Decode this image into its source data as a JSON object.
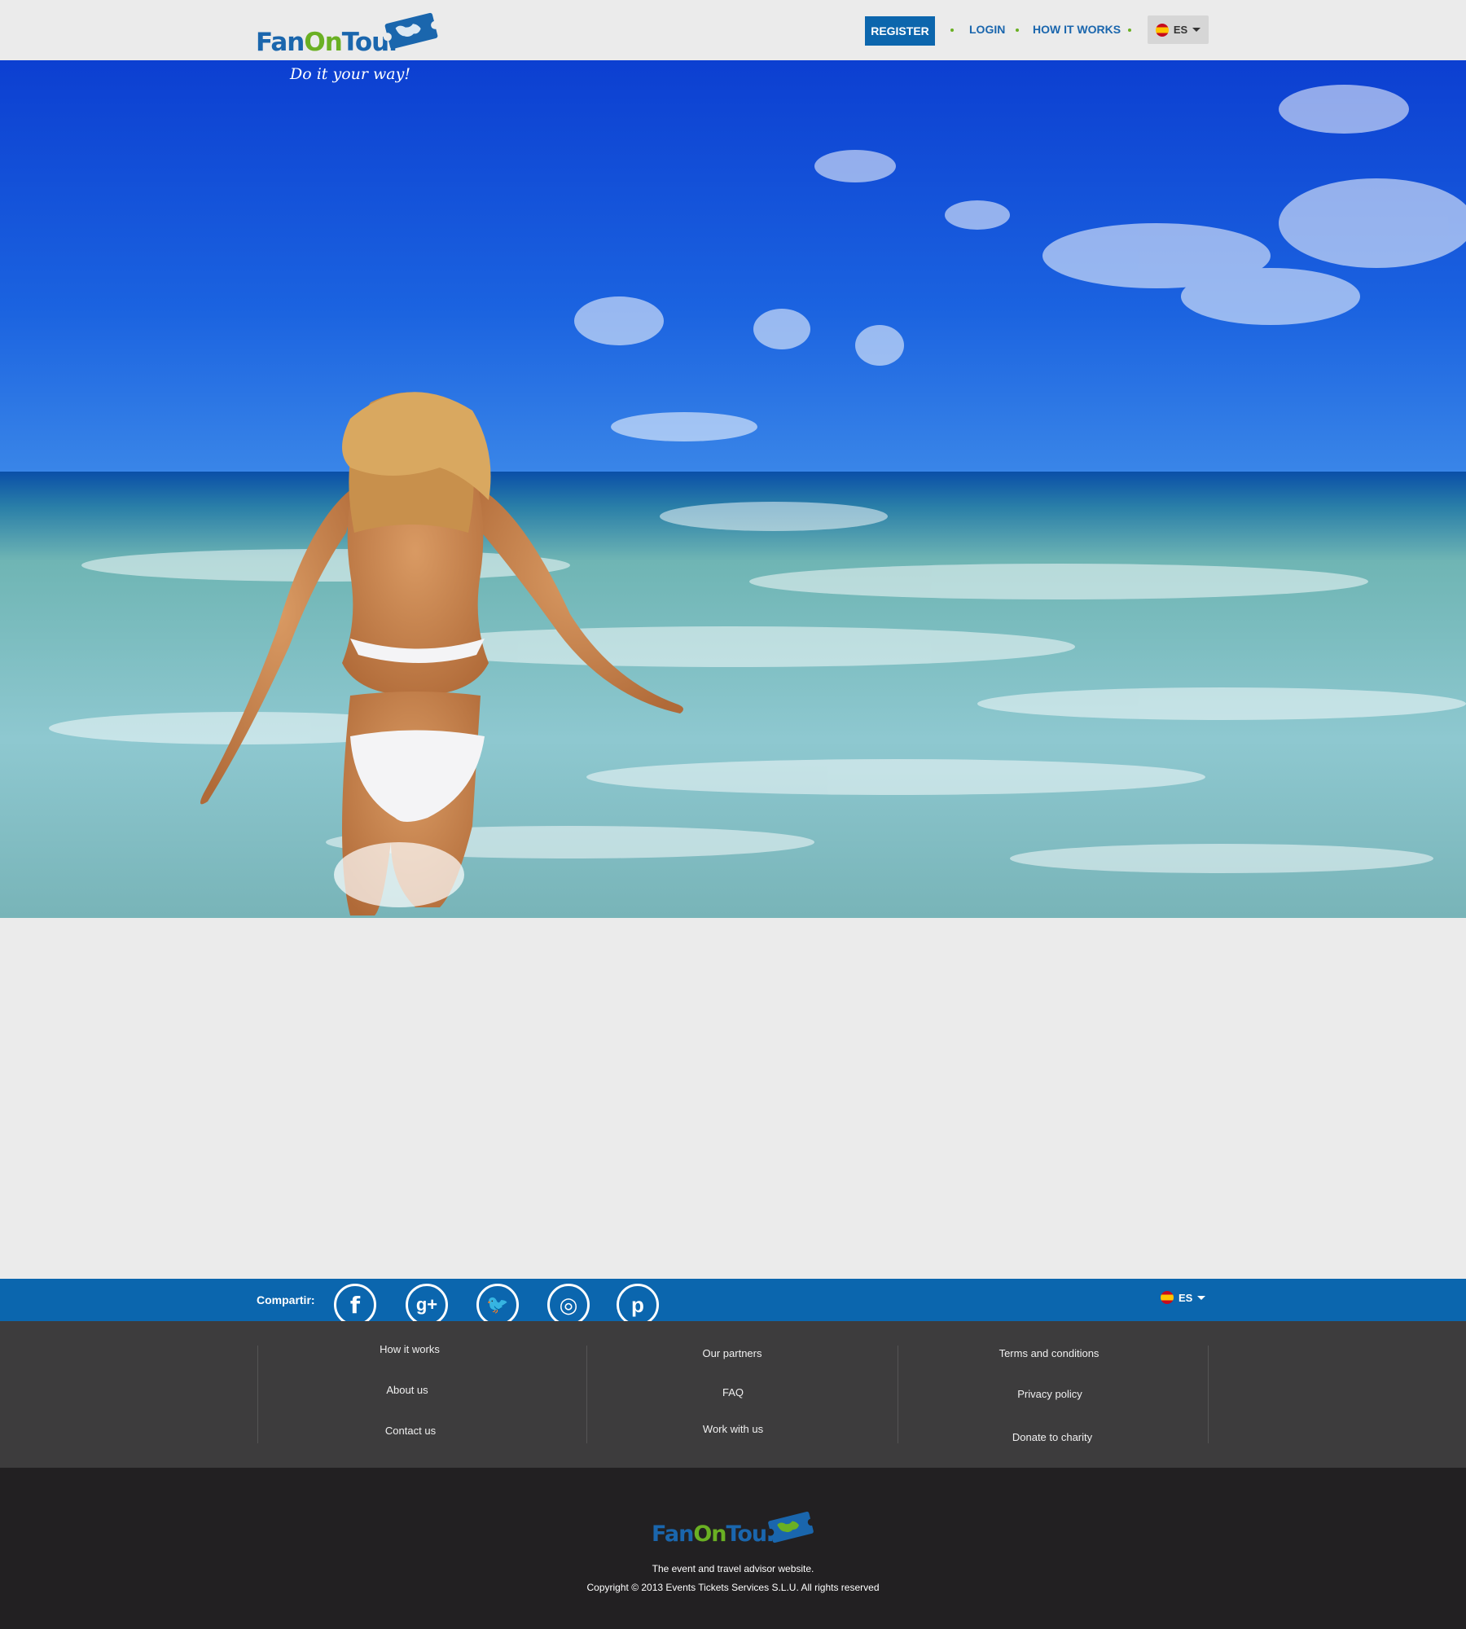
{
  "header": {
    "logo": {
      "part1": "Fan",
      "part2": "On",
      "part3": "Tour"
    },
    "tagline": "Do it your way!",
    "nav": {
      "register": "REGISTER",
      "login": "LOGIN",
      "how_it_works": "HOW IT WORKS",
      "language": "ES"
    }
  },
  "share": {
    "label": "Compartir:",
    "networks": [
      {
        "icon": "facebook-icon",
        "glyph": "f"
      },
      {
        "icon": "google-plus-icon",
        "glyph": "g+"
      },
      {
        "icon": "twitter-icon",
        "glyph": "🐦"
      },
      {
        "icon": "instagram-icon",
        "glyph": "◎"
      },
      {
        "icon": "pinterest-icon",
        "glyph": "p"
      }
    ],
    "language": "ES"
  },
  "footer": {
    "col1": [
      "How it works",
      "About us",
      "Contact us"
    ],
    "col2": [
      "Our partners",
      "FAQ",
      "Work with us"
    ],
    "col3": [
      "Terms and conditions",
      "Privacy policy",
      "Donate to charity"
    ],
    "logo": {
      "part1": "Fan",
      "part2": "On",
      "part3": "Tour"
    },
    "tagline": "The event and travel advisor website.",
    "copyright": "Copyright © 2013 Events Tickets Services S.L.U. All rights reserved"
  },
  "colors": {
    "brand_blue": "#0c66ad",
    "brand_green": "#6ab023",
    "footer_dark": "#3d3c3d",
    "footer_darker": "#222022"
  }
}
